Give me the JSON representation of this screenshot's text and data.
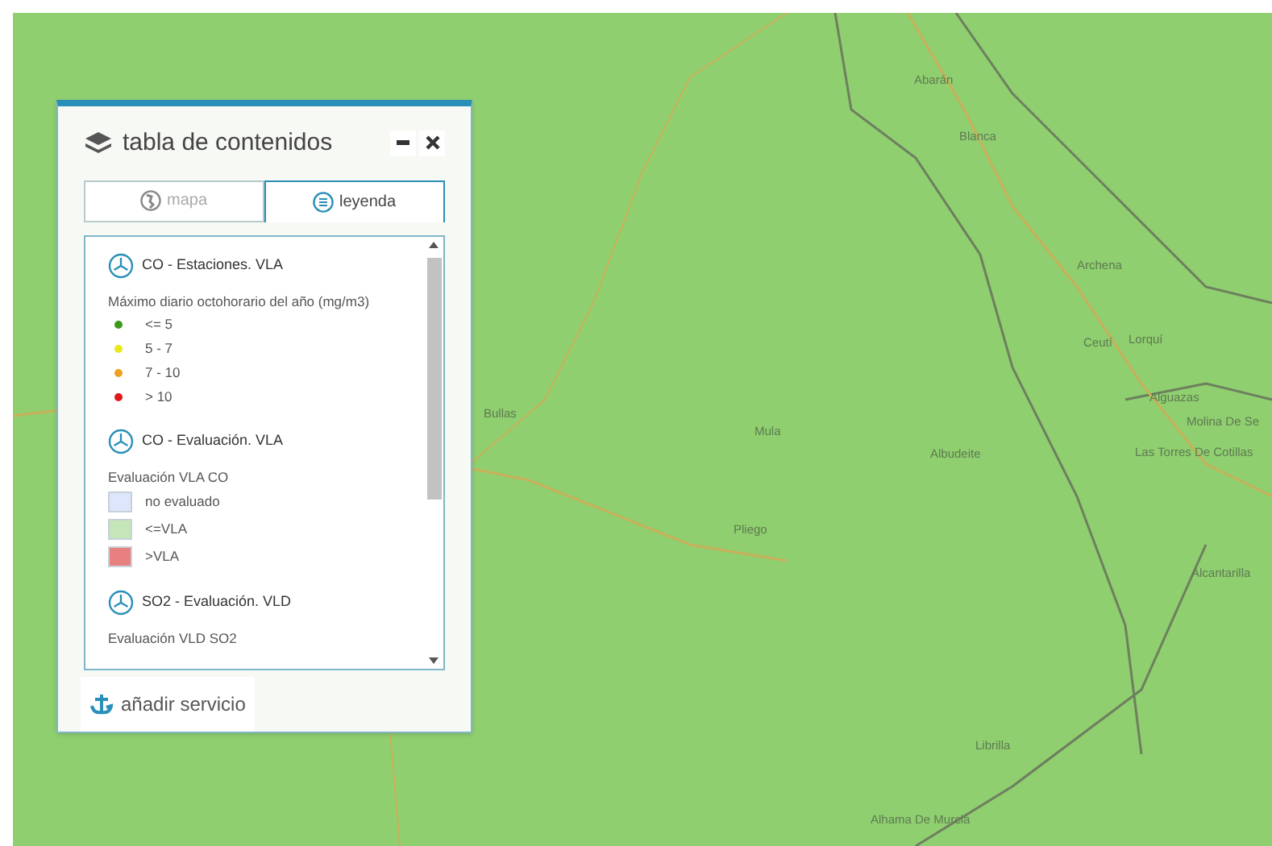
{
  "map_labels": [
    "Abarán",
    "Blanca",
    "Archena",
    "Ceutí",
    "Lorquí",
    "Alguazas",
    "Molina De Se",
    "Las Torres De Cotillas",
    "Bullas",
    "Mula",
    "Albudeite",
    "Pliego",
    "Alcantarilla",
    "Librilla",
    "Alhama De Murcia"
  ],
  "panel": {
    "title": "tabla de contenidos",
    "tabs": [
      {
        "label": "mapa",
        "selected": false
      },
      {
        "label": "leyenda",
        "selected": true
      }
    ],
    "layers": [
      {
        "title": "CO - Estaciones. VLA",
        "caption": "Máximo diario octohorario del año (mg/m3)",
        "items": [
          {
            "kind": "dot",
            "color": "#3a9a1e",
            "label": "<= 5"
          },
          {
            "kind": "dot",
            "color": "#e8e81a",
            "label": "5 - 7"
          },
          {
            "kind": "dot",
            "color": "#f0a020",
            "label": "7 - 10"
          },
          {
            "kind": "dot",
            "color": "#e01818",
            "label": "> 10"
          }
        ]
      },
      {
        "title": "CO - Evaluación. VLA",
        "caption": "Evaluación VLA CO",
        "items": [
          {
            "kind": "swatch",
            "color": "#dde6fa",
            "label": "no evaluado"
          },
          {
            "kind": "swatch",
            "color": "#c4e6b8",
            "label": "<=VLA"
          },
          {
            "kind": "swatch",
            "color": "#e88080",
            "label": ">VLA"
          }
        ]
      },
      {
        "title": "SO2 - Evaluación. VLD",
        "caption": "Evaluación VLD SO2"
      }
    ],
    "add_button": "añadir servicio"
  }
}
